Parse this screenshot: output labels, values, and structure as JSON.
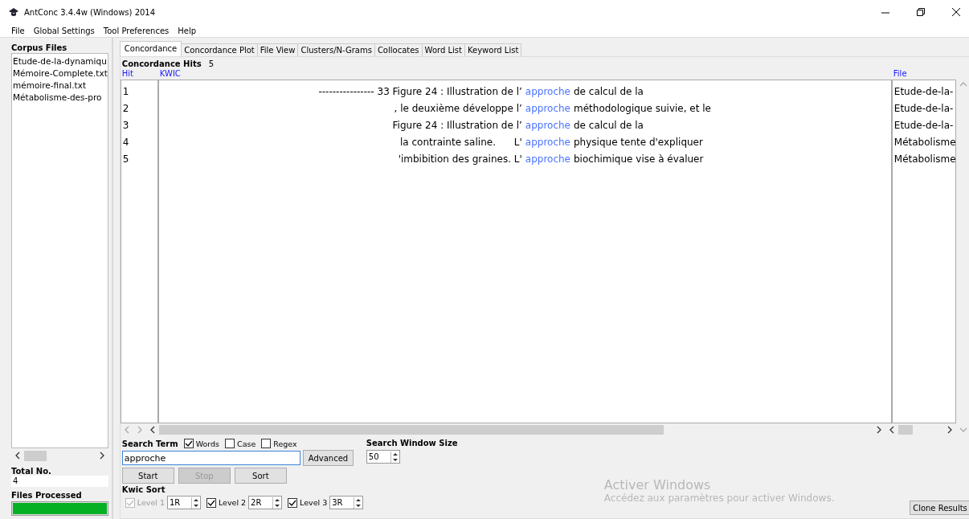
{
  "window": {
    "title": "AntConc 3.4.4w (Windows) 2014"
  },
  "menu": [
    "File",
    "Global Settings",
    "Tool Preferences",
    "Help"
  ],
  "sidebar": {
    "heading": "Corpus Files",
    "files": [
      "Etude-de-la-dynamiqu",
      "Mémoire-Complete.txt",
      "mémoire-final.txt",
      "Métabolisme-des-pro"
    ],
    "total_label": "Total No.",
    "total_value": "4",
    "processed_label": "Files Processed",
    "progress": {
      "level": 1
    }
  },
  "tabs": [
    {
      "label": "Concordance",
      "selected": true
    },
    {
      "label": "Concordance Plot",
      "selected": false
    },
    {
      "label": "File View",
      "selected": false
    },
    {
      "label": "Clusters/N-Grams",
      "selected": false
    },
    {
      "label": "Collocates",
      "selected": false
    },
    {
      "label": "Word List",
      "selected": false
    },
    {
      "label": "Keyword List",
      "selected": false
    }
  ],
  "hits": {
    "label": "Concordance Hits",
    "count": "5"
  },
  "table": {
    "columns": [
      "Hit",
      "KWIC",
      "File"
    ],
    "rows": [
      {
        "hit": "1",
        "left": "---------------- 33 Figure 24 : Illustration de l’",
        "keyword": "approche",
        "right": "de calcul de la",
        "file": "Etude-de-la-"
      },
      {
        "hit": "2",
        "left": ", le deuxième développe l’",
        "keyword": "approche",
        "right": "méthodologique suivie, et le",
        "file": "Etude-de-la-"
      },
      {
        "hit": "3",
        "left": "Figure 24 : Illustration de l’",
        "keyword": "approche",
        "right": "de calcul de la",
        "file": "Etude-de-la-"
      },
      {
        "hit": "4",
        "left": "la contrainte saline.      L'",
        "keyword": "approche",
        "right": "physique tente d'expliquer",
        "file": "Métabolisme"
      },
      {
        "hit": "5",
        "left": "'imbibition des graines. L'",
        "keyword": "approche",
        "right": "biochimique vise à évaluer",
        "file": "Métabolisme"
      }
    ]
  },
  "search": {
    "label": "Search Term",
    "options": [
      {
        "label": "Words",
        "checked": true
      },
      {
        "label": "Case",
        "checked": false
      },
      {
        "label": "Regex",
        "checked": false
      }
    ],
    "value": "approche",
    "advanced": "Advanced"
  },
  "window_size": {
    "label": "Search Window Size",
    "value": "50"
  },
  "buttons": [
    {
      "label": "Start",
      "disabled": false
    },
    {
      "label": "Stop",
      "disabled": true
    },
    {
      "label": "Sort",
      "disabled": false
    }
  ],
  "kwic_sort": {
    "label": "Kwic Sort",
    "levels": [
      {
        "label": "Level 1",
        "checked": true,
        "disabled": true,
        "value": "1R"
      },
      {
        "label": "Level 2",
        "checked": true,
        "disabled": false,
        "value": "2R"
      },
      {
        "label": "Level 3",
        "checked": true,
        "disabled": false,
        "value": "3R"
      }
    ]
  },
  "os_notice": {
    "title": "Activer Windows",
    "text": "Accédez aux paramètres pour activer Windows."
  },
  "clone_button": "Clone Results"
}
